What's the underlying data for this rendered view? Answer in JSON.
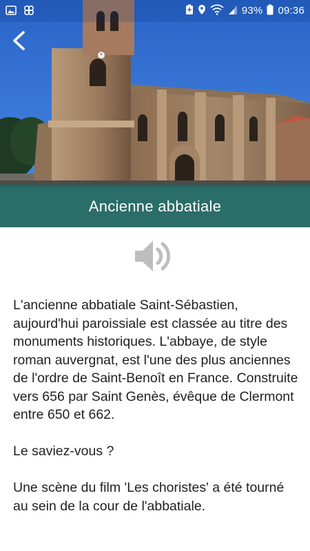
{
  "status_bar": {
    "battery_percent": "93%",
    "time": "09:36",
    "left_icons": [
      "image-icon",
      "app-notification-icon"
    ],
    "right_icons": [
      "battery-saver-icon",
      "location-icon",
      "wifi-icon",
      "cell-signal-icon",
      "battery-icon"
    ]
  },
  "header": {
    "back_icon": "chevron-left-icon",
    "title": "Ancienne abbatiale"
  },
  "audio": {
    "icon": "speaker-icon"
  },
  "content": {
    "paragraph_1": "L'ancienne abbatiale Saint-Sébastien, aujourd'hui paroissiale est classée au titre des monuments historiques. L'abbaye, de style roman auvergnat, est l'une des plus anciennes de l'ordre de Saint-Benoît en France. Construite vers 656 par Saint Genès, évêque de Clermont entre 650 et 662.",
    "paragraph_2": "Le saviez-vous ?",
    "paragraph_3": "Une scène du  film 'Les choristes' a été tourné au sein de la cour de l'abbatiale."
  },
  "colors": {
    "title_band": "#186e6a",
    "sky": "#2f6fd0",
    "body_text": "#222222",
    "speaker_icon": "#bdbdbd"
  }
}
